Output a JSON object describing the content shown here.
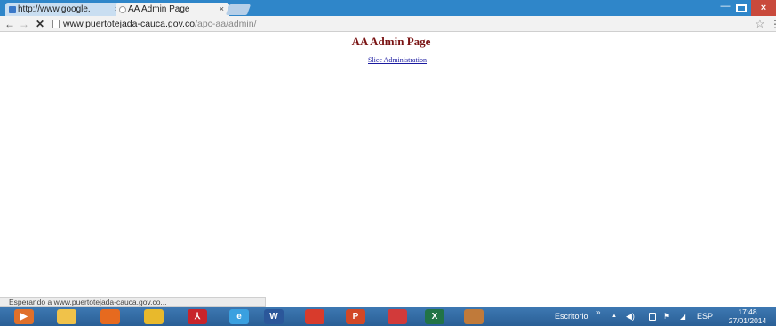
{
  "browser": {
    "tabs": [
      {
        "label": "http://www.google.",
        "active": false
      },
      {
        "label": "AA Admin Page",
        "active": true
      }
    ],
    "tab_close_glyph": "×",
    "window_controls": {
      "minimize": "—",
      "close": "×"
    },
    "url": {
      "host": "www.puertotejada-cauca.gov.co",
      "path": "/apc-aa/admin/"
    },
    "nav": {
      "back": "←",
      "forward": "→",
      "stop": "✕"
    },
    "star_glyph": "☆",
    "menu_glyph": "⋮"
  },
  "page": {
    "title": "AA Admin Page",
    "link": "Slice Administration"
  },
  "status_text": "Esperando a www.puertotejada-cauca.gov.co...",
  "taskbar": {
    "apps": [
      {
        "name": "media-player-icon",
        "color": "#e0702a",
        "glyph": "▶"
      },
      {
        "name": "file-explorer-icon",
        "color": "#f0c24a",
        "glyph": ""
      },
      {
        "name": "firefox-icon",
        "color": "#e66a1f",
        "glyph": ""
      },
      {
        "name": "chrome-icon",
        "color": "#e8b92c",
        "glyph": ""
      },
      {
        "name": "adobe-reader-icon",
        "color": "#c8242b",
        "glyph": "⅄"
      },
      {
        "name": "internet-explorer-icon",
        "color": "#3aa0e0",
        "glyph": "e"
      },
      {
        "name": "word-icon",
        "color": "#2b579a",
        "glyph": "W"
      },
      {
        "name": "app-icon",
        "color": "#d83b2c",
        "glyph": ""
      },
      {
        "name": "powerpoint-icon",
        "color": "#d24726",
        "glyph": "P"
      },
      {
        "name": "chrome-red-icon",
        "color": "#d23a3a",
        "glyph": ""
      },
      {
        "name": "excel-icon",
        "color": "#217346",
        "glyph": "X"
      },
      {
        "name": "calculator-icon",
        "color": "#c07a3a",
        "glyph": ""
      }
    ],
    "desktop_label": "Escritorio",
    "desktop_chevron": "»",
    "tray_arrow": "▲",
    "speaker": "◀)",
    "language": "ESP",
    "time": "17:48",
    "date": "27/01/2014"
  }
}
